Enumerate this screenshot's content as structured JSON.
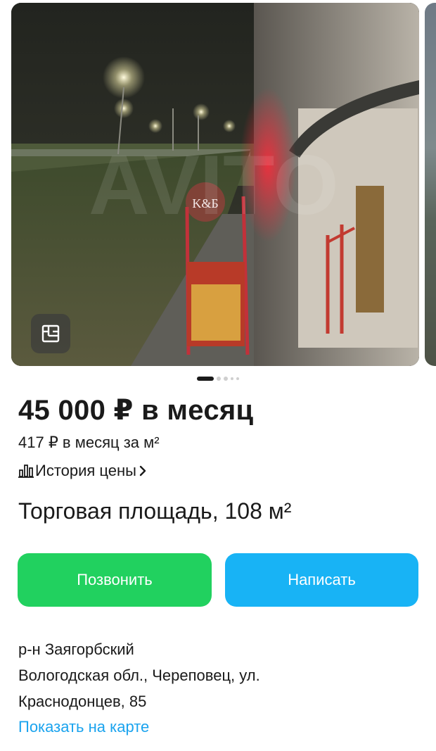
{
  "listing": {
    "price": "45 000 ₽ в месяц",
    "price_per_m2": "417 ₽ в месяц за м²",
    "price_history_label": "История цены",
    "title": "Торговая площадь, 108 м²",
    "watermark": "K&Б"
  },
  "gallery": {
    "pages": 5,
    "current_page": 1
  },
  "actions": {
    "call_label": "Позвонить",
    "write_label": "Написать",
    "call_color": "#21d15f",
    "write_color": "#18b3f5"
  },
  "address": {
    "district": "р-н Заягорбский",
    "line1": "Вологодская обл., Череповец, ул.",
    "line2": "Краснодонцев, 85",
    "map_link": "Показать на карте"
  },
  "icons": {
    "gallery_button": "gallery-plan-icon",
    "history": "bar-chart-icon",
    "history_chevron": "chevron-right-icon"
  }
}
